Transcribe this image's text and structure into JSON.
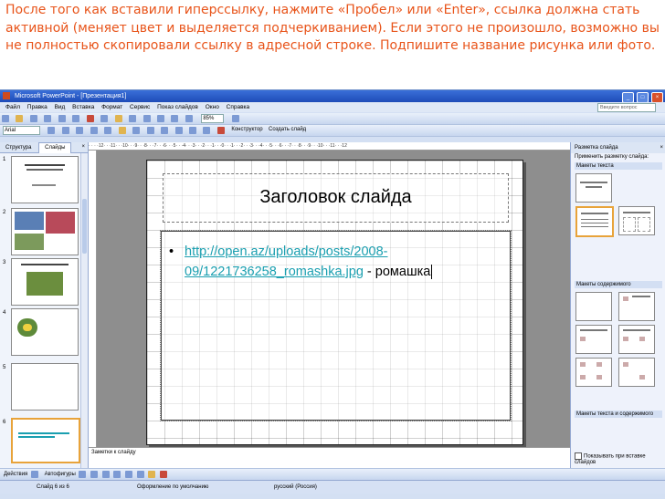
{
  "caption": "После того как вставили гиперссылку, нажмите «Пробел» или «Enter», ссылка должна стать активной (меняет цвет и выделяется подчеркиванием). Если этого не произошло, возможно вы не полностью скопировали ссылку в адресной строке. Подпишите название рисунка или фото.",
  "window": {
    "title": "Microsoft PowerPoint - [Презентация1]",
    "minimize": "_",
    "maximize": "□",
    "close": "×"
  },
  "menu": {
    "items": [
      "Файл",
      "Правка",
      "Вид",
      "Вставка",
      "Формат",
      "Сервис",
      "Показ слайдов",
      "Окно",
      "Справка"
    ],
    "help_placeholder": "Введите вопрос"
  },
  "toolbar": {
    "font": "Arial",
    "zoom": "85%",
    "designer": "Конструктор",
    "new_slide": "Создать слайд"
  },
  "left_panel": {
    "tabs": [
      "Структура",
      "Слайды"
    ],
    "close": "×",
    "slide_numbers": [
      "1",
      "2",
      "3",
      "4",
      "5",
      "6"
    ]
  },
  "slide": {
    "title": "Заголовок слайда",
    "bullet": "•",
    "link_text": "http://open.az/uploads/posts/2008-09/1221736258_romashka.jpg",
    "after_link": " - ромашка"
  },
  "notes": "Заметки к слайду",
  "right_panel": {
    "title": "Разметка слайда",
    "close": "×",
    "apply_label": "Применить разметку слайда:",
    "sections": [
      "Макеты текста",
      "Макеты содержимого",
      "Макеты текста и содержимого"
    ],
    "footer": "Показывать при вставке слайдов"
  },
  "drawing_toolbar": {
    "actions": "Действия",
    "autoshapes": "Автофигуры"
  },
  "status": {
    "slide": "Слайд 6 из 6",
    "design": "Оформление по умолчанию",
    "language": "русский (Россия)"
  }
}
